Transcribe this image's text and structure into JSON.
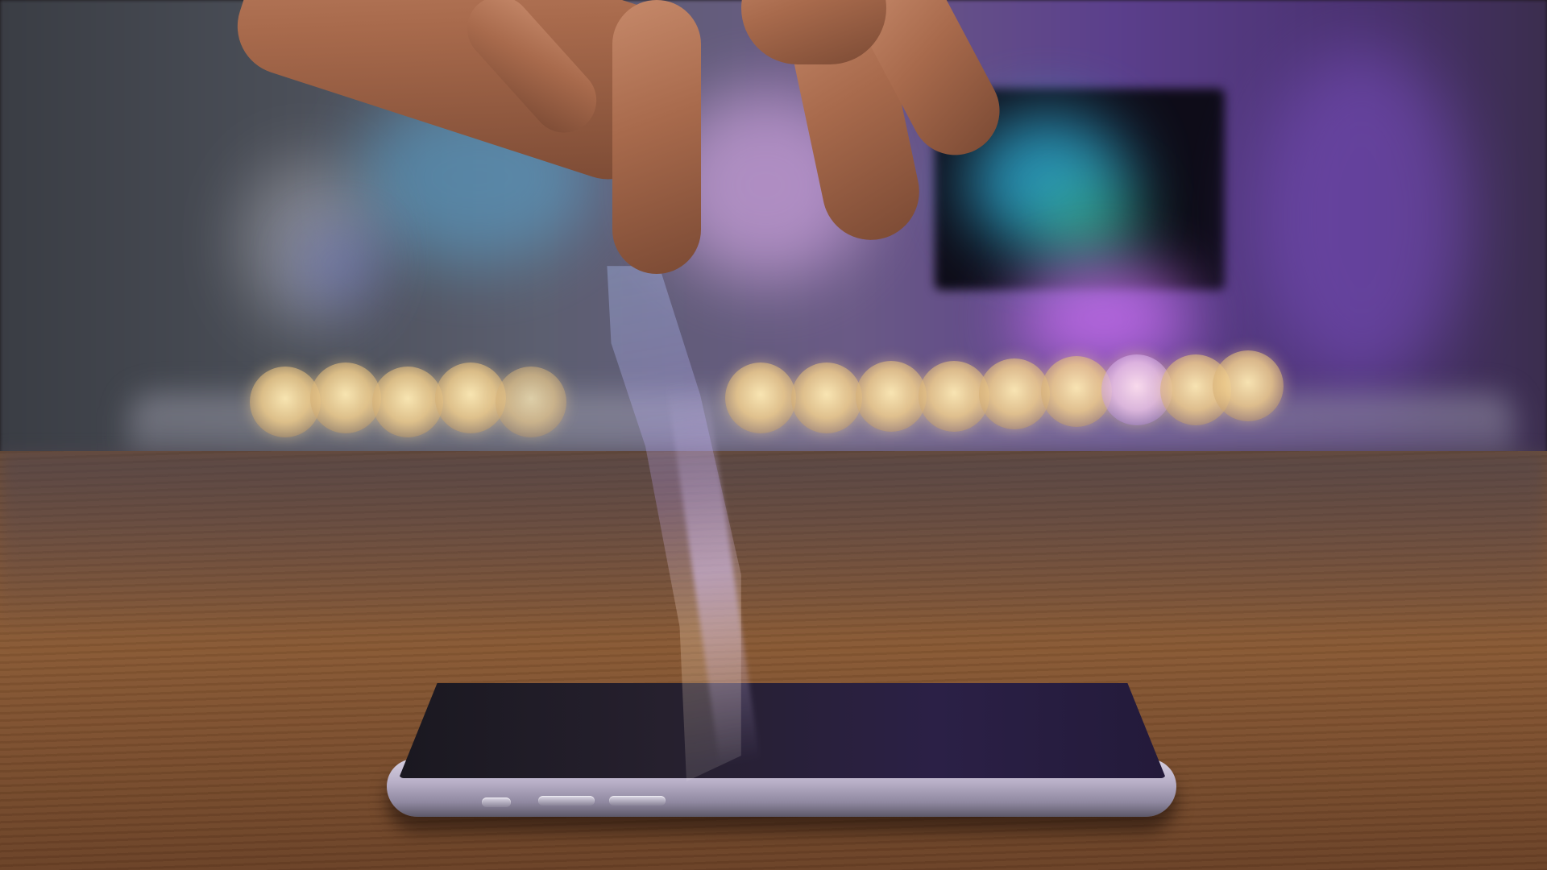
{
  "scene": {
    "description_free": true,
    "accent_colors": {
      "wall": "#5c5f70",
      "purple_light": "#6a3fa8",
      "bokeh_warm": "#f0cd8c",
      "table_wood": "#7a5236",
      "phone_frame": "#b9b0c8"
    },
    "elements": {
      "phone": "smartphone-lying-flat",
      "film": "screen-protector-film",
      "hand": "hand-peeling-film",
      "bokeh_count_left": 5,
      "bokeh_count_right": 9
    }
  }
}
